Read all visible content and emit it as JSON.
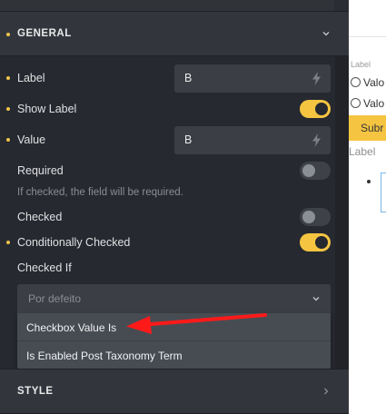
{
  "panel": {
    "general_section": {
      "title": "GENERAL"
    },
    "label_field": {
      "label": "Label",
      "value": "B"
    },
    "show_label": {
      "label": "Show Label",
      "checked": true
    },
    "value_field": {
      "label": "Value",
      "value": "B"
    },
    "required": {
      "label": "Required",
      "checked": false,
      "hint": "If checked, the field will be required."
    },
    "checked": {
      "label": "Checked",
      "checked": false
    },
    "conditionally_checked": {
      "label": "Conditionally Checked",
      "checked": true
    },
    "checked_if": {
      "label": "Checked If",
      "placeholder": "Por defeito",
      "options": [
        "Checkbox Value Is",
        "Is Enabled Post Taxonomy Term"
      ]
    },
    "style_section": {
      "title": "STYLE"
    }
  },
  "preview": {
    "field_label": "Label",
    "radio_options": [
      "Valo",
      "Valo"
    ],
    "submit_label": "Subr",
    "second_label": "Label"
  },
  "colors": {
    "accent": "#f5c542",
    "panel_bg": "#26292f",
    "arrow": "#ff1a1a"
  }
}
